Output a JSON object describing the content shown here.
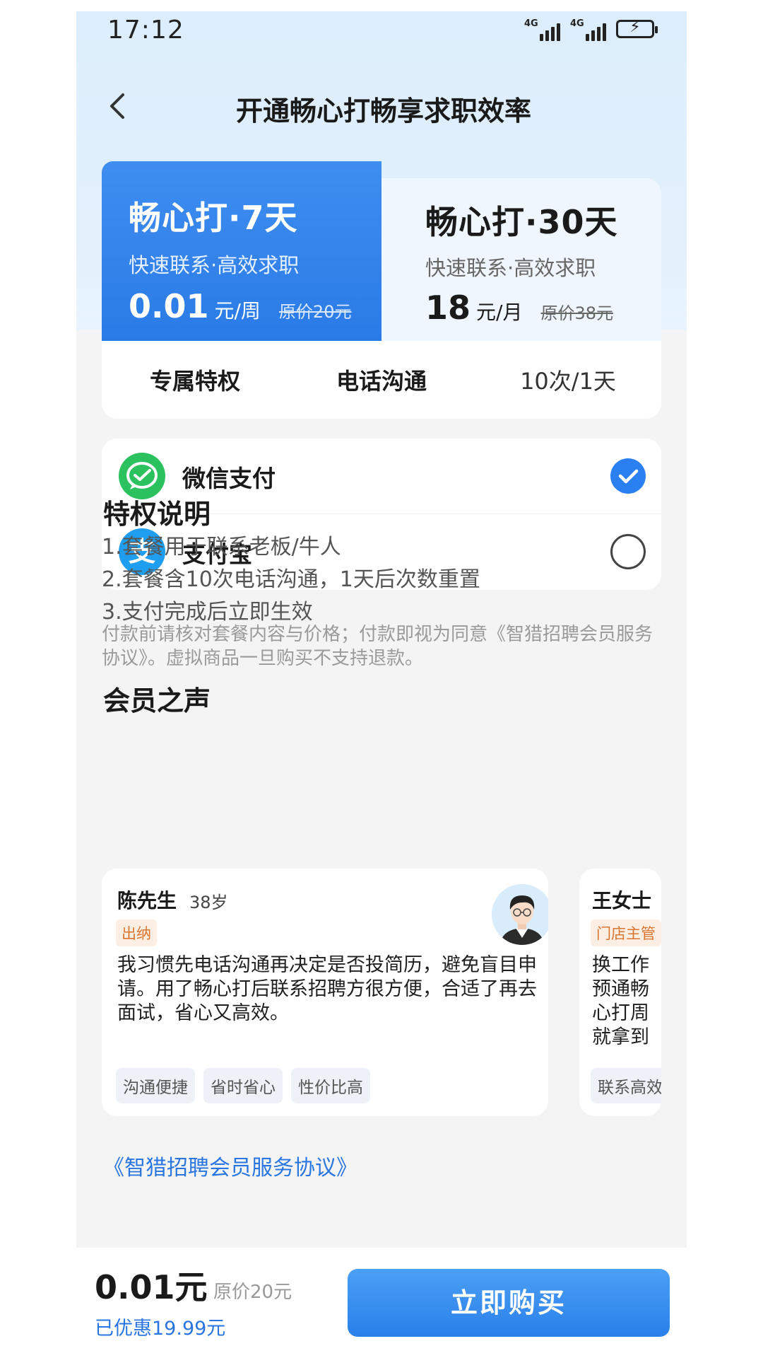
{
  "status_bar": {
    "time": "17:12",
    "net1": "4G",
    "net2": "4G",
    "battery_icon": "battery-charging-icon"
  },
  "header": {
    "back_icon": "chevron-left-icon",
    "title": "开通畅心打畅享求职效率"
  },
  "plans": [
    {
      "name": "畅心打·7天",
      "subtitle": "快速联系·高效求职",
      "price": "0.01",
      "unit": "元/周",
      "original": "原价20元",
      "selected": true
    },
    {
      "name": "畅心打·30天",
      "subtitle": "快速联系·高效求职",
      "price": "18",
      "unit": "元/月",
      "original": "原价38元",
      "selected": false
    }
  ],
  "privilege_row": {
    "label": "专属特权",
    "feature": "电话沟通",
    "quota": "10次/1天"
  },
  "payment": [
    {
      "label": "微信支付",
      "icon": "wechat-pay-icon",
      "selected": true
    },
    {
      "label": "支付宝",
      "icon": "alipay-icon",
      "selected": false
    }
  ],
  "privilege_desc": {
    "title": "特权说明",
    "lines": [
      "1.套餐用于联系老板/牛人",
      "2.套餐含10次电话沟通，1天后次数重置",
      "3.支付完成后立即生效"
    ],
    "note": "付款前请核对套餐内容与价格；付款即视为同意《智猎招聘会员服务协议》。虚拟商品一旦购买不支持退款。"
  },
  "testimonials_title": "会员之声",
  "testimonials": [
    {
      "name": "陈先生",
      "age": "38岁",
      "role": "出纳",
      "text": "我习惯先电话沟通再决定是否投简历，避免盲目申请。用了畅心打后联系招聘方很方便，合适了再去面试，省心又高效。",
      "tags": [
        "沟通便捷",
        "省时省心",
        "性价比高"
      ]
    },
    {
      "name": "王女士",
      "role": "门店主管",
      "text": "换工作预通畅心打周就拿到",
      "tags": [
        "联系高效"
      ]
    }
  ],
  "agreement_link": "《智猎招聘会员服务协议》",
  "bottom": {
    "total": "0.01元",
    "original": "原价20元",
    "saved": "已优惠19.99元",
    "buy_label": "立即购买"
  },
  "colors": {
    "accent": "#2a80f0",
    "wechat": "#2bc15e",
    "alipay": "#1f9ef0",
    "role_tag": "#d8752f"
  }
}
